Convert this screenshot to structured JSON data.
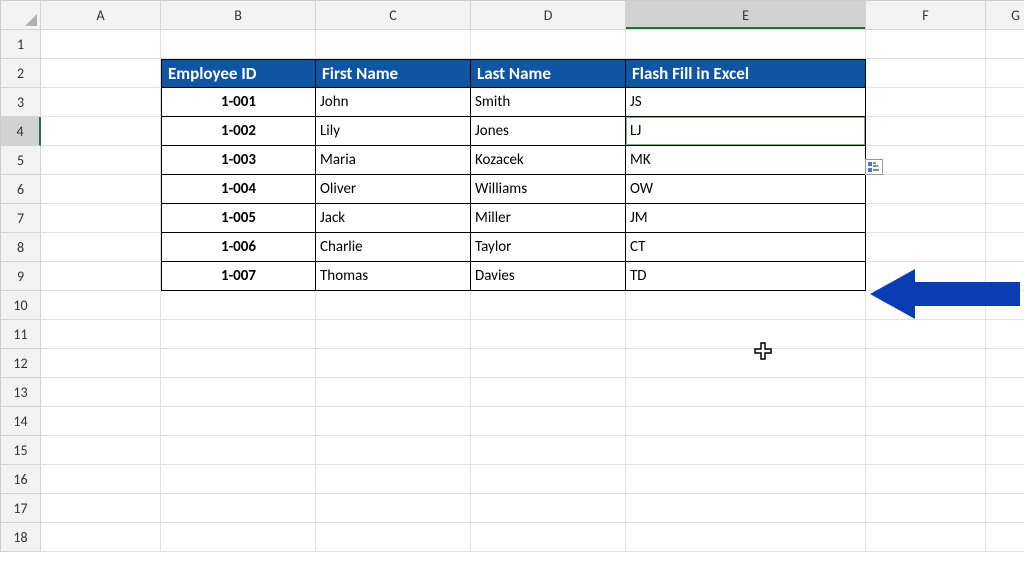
{
  "columns": [
    "A",
    "B",
    "C",
    "D",
    "E",
    "F",
    "G"
  ],
  "rows": [
    "1",
    "2",
    "3",
    "4",
    "5",
    "6",
    "7",
    "8",
    "9",
    "10",
    "11",
    "12",
    "13",
    "14",
    "15",
    "16",
    "17",
    "18"
  ],
  "activeCol": 4,
  "activeRow": 3,
  "table": {
    "headers": {
      "b": "Employee ID",
      "c": "First Name",
      "d": "Last Name",
      "e": "Flash Fill in Excel"
    },
    "rows": [
      {
        "b": "1-001",
        "c": "John",
        "d": "Smith",
        "e": "JS"
      },
      {
        "b": "1-002",
        "c": "Lily",
        "d": "Jones",
        "e": "LJ"
      },
      {
        "b": "1-003",
        "c": "Maria",
        "d": "Kozacek",
        "e": "MK"
      },
      {
        "b": "1-004",
        "c": "Oliver",
        "d": "Williams",
        "e": "OW"
      },
      {
        "b": "1-005",
        "c": "Jack",
        "d": "Miller",
        "e": "JM"
      },
      {
        "b": "1-006",
        "c": "Charlie",
        "d": "Taylor",
        "e": "CT"
      },
      {
        "b": "1-007",
        "c": "Thomas",
        "d": "Davies",
        "e": "TD"
      }
    ]
  },
  "arrowColor": "#0a3db3"
}
